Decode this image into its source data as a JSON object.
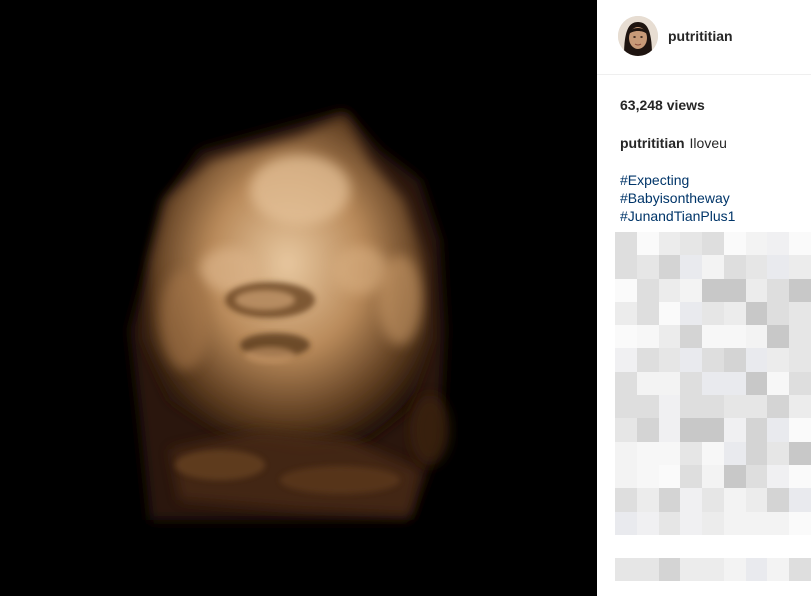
{
  "post": {
    "username": "putrititian",
    "views": "63,248 views",
    "caption_user": "putrititian",
    "caption_text": "Iloveu",
    "hashtags": [
      "#Expecting",
      "#Babyisontheway",
      "#JunandTianPlus1"
    ]
  },
  "colors": {
    "media_background": "#000000",
    "hashtag": "#003569",
    "text": "#262626",
    "ultrasound_tone": "#c9a074"
  },
  "icons": [
    "avatar"
  ]
}
